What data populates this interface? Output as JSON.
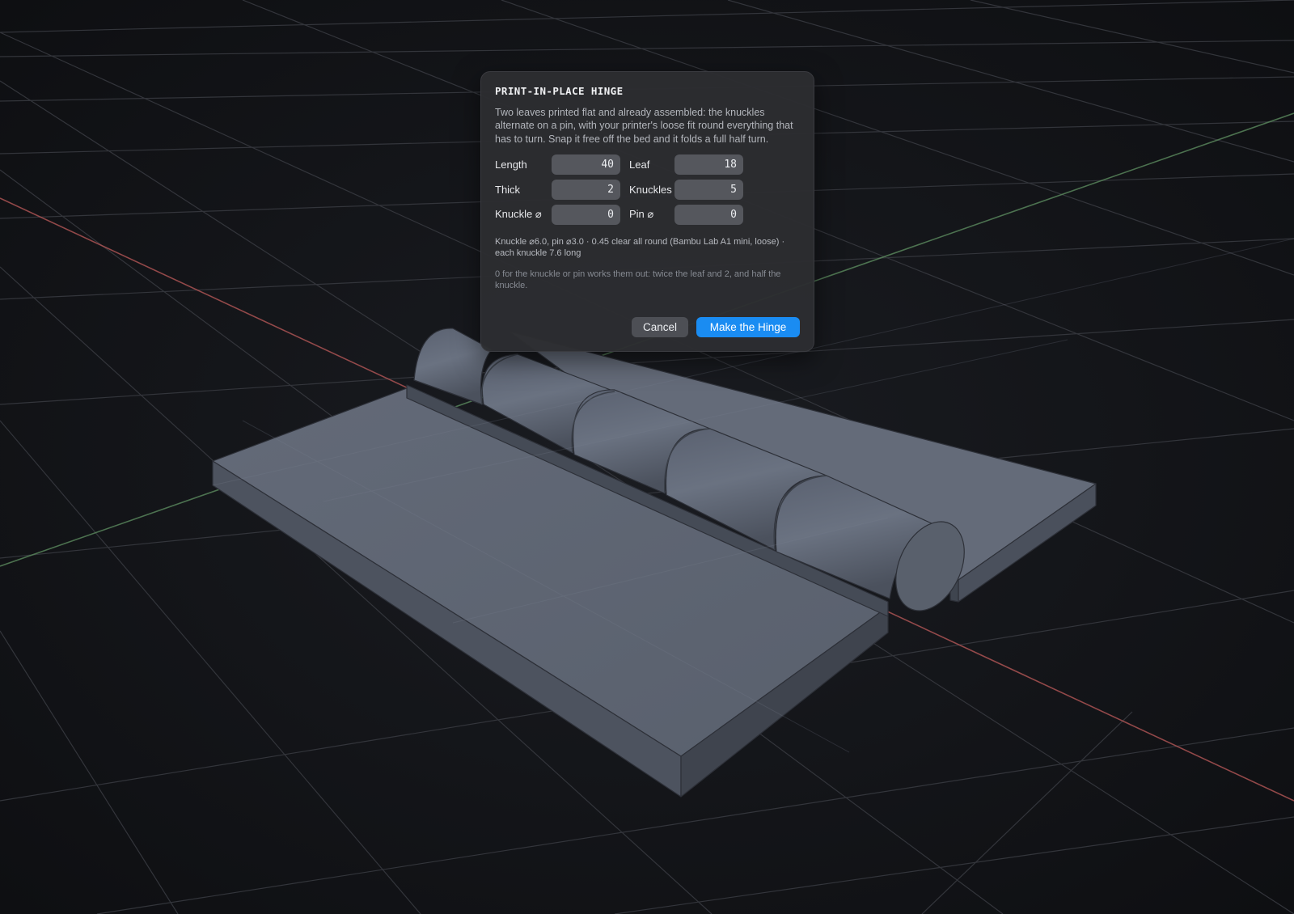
{
  "dialog": {
    "title": "PRINT-IN-PLACE HINGE",
    "description": "Two leaves printed flat and already assembled: the knuckles alternate on a pin, with your printer's loose fit round everything that has to turn. Snap it free off the bed and it folds a full half turn.",
    "fields": {
      "length": {
        "label": "Length",
        "value": "40"
      },
      "leaf": {
        "label": "Leaf",
        "value": "18"
      },
      "thick": {
        "label": "Thick",
        "value": "2"
      },
      "knuckles": {
        "label": "Knuckles",
        "value": "5"
      },
      "knuckle_dia": {
        "label": "Knuckle ⌀",
        "value": "0"
      },
      "pin_dia": {
        "label": "Pin ⌀",
        "value": "0"
      }
    },
    "summary": "Knuckle ⌀6.0, pin ⌀3.0 · 0.45 clear all round (Bambu Lab A1 mini, loose) · each knuckle 7.6 long",
    "note": "0 for the knuckle or pin works them out: twice the leaf and 2, and half the knuckle.",
    "buttons": {
      "cancel": "Cancel",
      "confirm": "Make the Hinge"
    }
  },
  "viewport": {
    "background_color": "#121317",
    "grid_color": "#3a3c42",
    "x_axis_color": "#b35656",
    "y_axis_color": "#5b8a5e",
    "model_color": "#5f6674"
  }
}
